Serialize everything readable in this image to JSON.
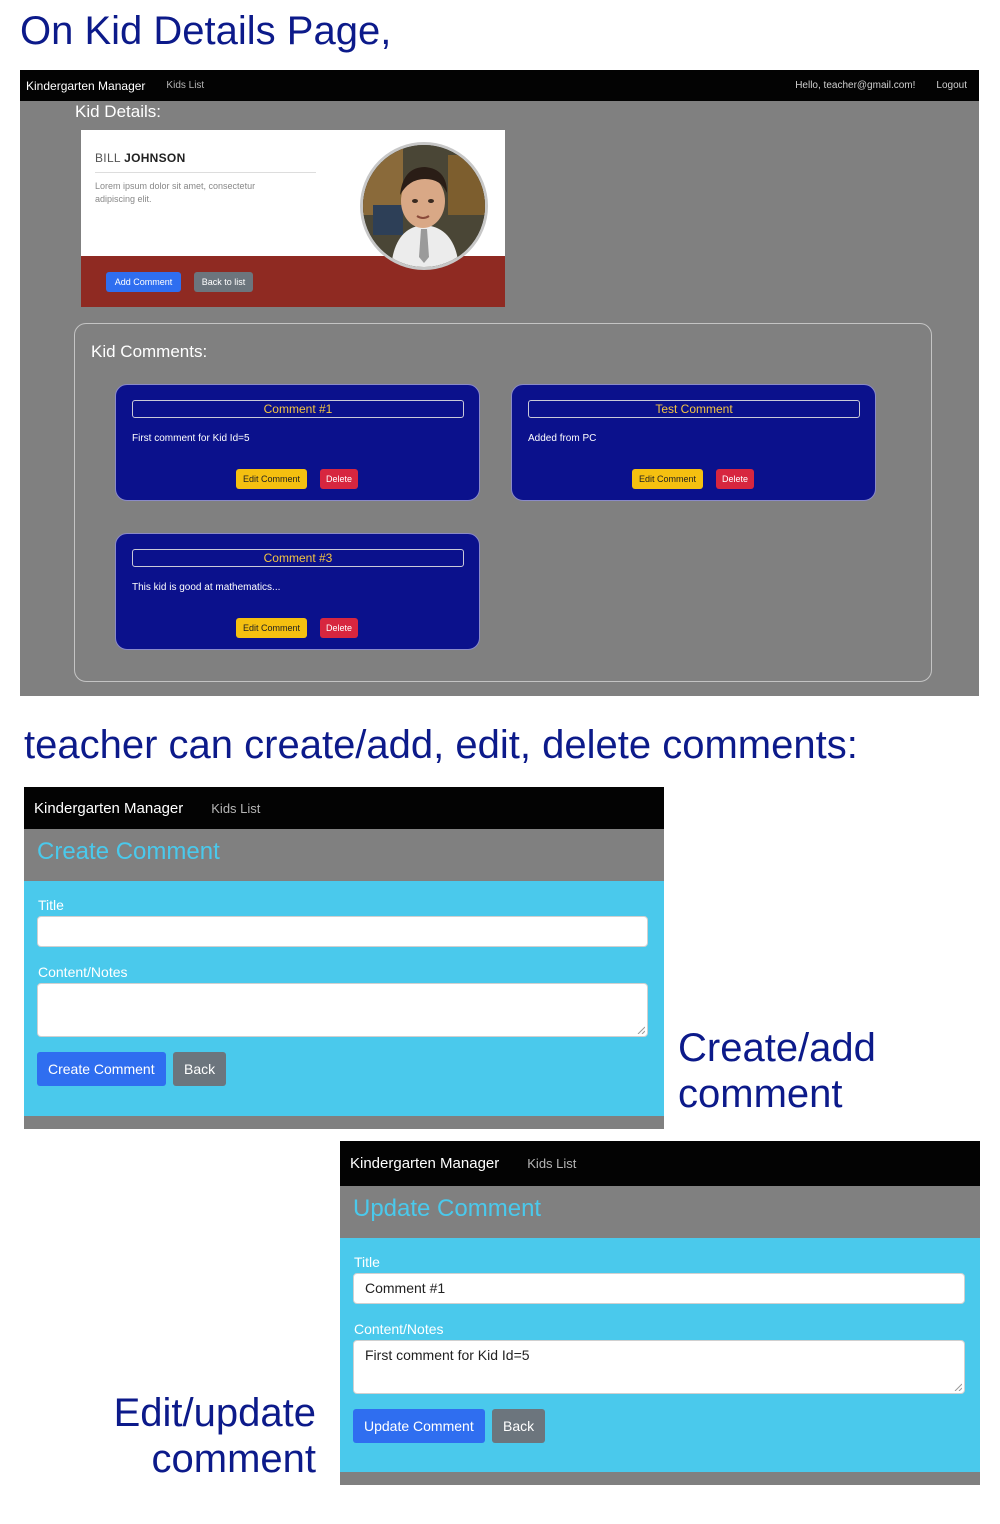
{
  "captions": {
    "top": "On Kid Details Page,",
    "middle": "teacher can create/add, edit, delete comments:",
    "create": "Create/add comment",
    "edit": "Edit/update comment"
  },
  "details_page": {
    "navbar": {
      "brand": "Kindergarten Manager",
      "kids_list": "Kids List",
      "greeting": "Hello, teacher@gmail.com!",
      "logout": "Logout"
    },
    "heading": "Kid Details:",
    "kid": {
      "first_name": "BILL",
      "last_name": "JOHNSON",
      "description": "Lorem ipsum dolor sit amet, consectetur adipiscing elit."
    },
    "buttons": {
      "add_comment": "Add Comment",
      "back_to_list": "Back to list"
    },
    "comments_heading": "Kid Comments:",
    "comments": [
      {
        "title": "Comment #1",
        "body": "First comment for Kid Id=5",
        "edit": "Edit Comment",
        "delete": "Delete"
      },
      {
        "title": "Test Comment",
        "body": "Added from PC",
        "edit": "Edit Comment",
        "delete": "Delete"
      },
      {
        "title": "Comment #3",
        "body": "This kid is good at mathematics...",
        "edit": "Edit Comment",
        "delete": "Delete"
      }
    ]
  },
  "create_page": {
    "navbar": {
      "brand": "Kindergarten Manager",
      "kids_list": "Kids List"
    },
    "heading": "Create Comment",
    "title_label": "Title",
    "title_value": "",
    "content_label": "Content/Notes",
    "content_value": "",
    "submit": "Create Comment",
    "back": "Back"
  },
  "update_page": {
    "navbar": {
      "brand": "Kindergarten Manager",
      "kids_list": "Kids List"
    },
    "heading": "Update Comment",
    "title_label": "Title",
    "title_value": "Comment #1",
    "content_label": "Content/Notes",
    "content_value": "First comment for Kid Id=5",
    "submit": "Update Comment",
    "back": "Back"
  },
  "colors": {
    "caption": "#0c1a8a",
    "page_bg": "#808080",
    "form_bg": "#4ac9ec",
    "comment_card": "#0b118c",
    "comment_title": "#f4c542",
    "card_footer": "#8f2a22"
  }
}
